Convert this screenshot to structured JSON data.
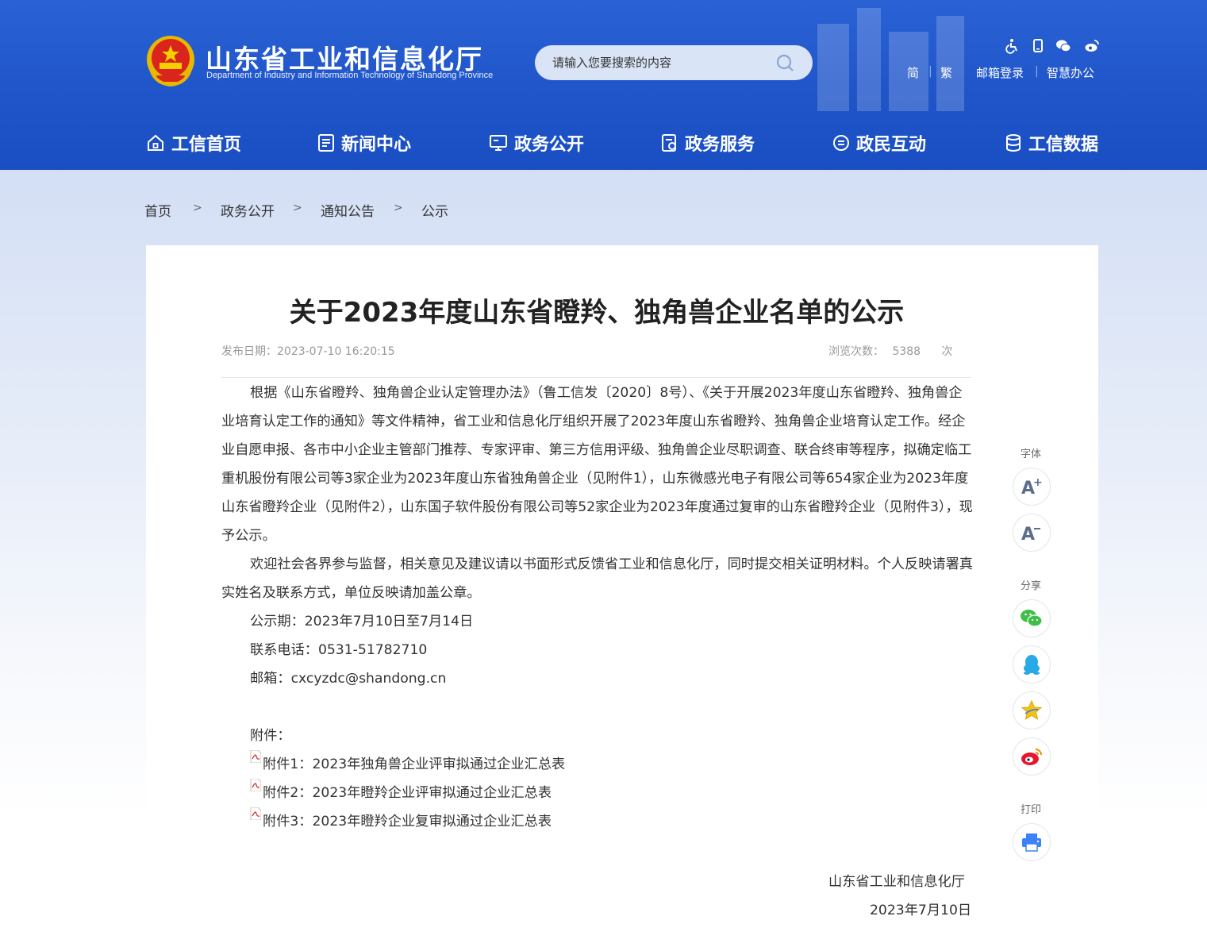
{
  "header": {
    "title": "山东省工业和信息化厅",
    "subtitle": "Department of Industry and Information Technology of Shandong Province",
    "search_placeholder": "请输入您要搜索的内容",
    "links": {
      "simplified": "简",
      "traditional": "繁",
      "mail_login": "邮箱登录",
      "smart_office": "智慧办公"
    },
    "separator": "|"
  },
  "nav": [
    {
      "label": "工信首页",
      "icon": "home-icon"
    },
    {
      "label": "新闻中心",
      "icon": "news-icon"
    },
    {
      "label": "政务公开",
      "icon": "monitor-icon"
    },
    {
      "label": "政务服务",
      "icon": "service-icon"
    },
    {
      "label": "政民互动",
      "icon": "chat-icon"
    },
    {
      "label": "工信数据",
      "icon": "database-icon"
    }
  ],
  "breadcrumb": {
    "items": [
      "首页",
      "政务公开",
      "通知公告",
      "公示"
    ],
    "sep": ">"
  },
  "article": {
    "title": "关于2023年度山东省瞪羚、独角兽企业名单的公示",
    "publish_label": "发布日期：",
    "publish_date": "2023-07-10 16:20:15",
    "views_label": "浏览次数：",
    "views": "5388",
    "views_unit": "次",
    "p1": "根据《山东省瞪羚、独角兽企业认定管理办法》（鲁工信发〔2020〕8号）、《关于开展2023年度山东省瞪羚、独角兽企业培育认定工作的通知》等文件精神，省工业和信息化厅组织开展了2023年度山东省瞪羚、独角兽企业培育认定工作。经企业自愿申报、各市中小企业主管部门推荐、专家评审、第三方信用评级、独角兽企业尽职调查、联合终审等程序，拟确定临工重机股份有限公司等3家企业为2023年度山东省独角兽企业（见附件1），山东微感光电子有限公司等654家企业为2023年度山东省瞪羚企业（见附件2），山东国子软件股份有限公司等52家企业为2023年度通过复审的山东省瞪羚企业（见附件3），现予公示。",
    "p2": "欢迎社会各界参与监督，相关意见及建议请以书面形式反馈省工业和信息化厅，同时提交相关证明材料。个人反映请署真实姓名及联系方式，单位反映请加盖公章。",
    "period": "公示期：2023年7月10日至7月14日",
    "phone": "联系电话：0531-51782710",
    "email": "邮箱：cxcyzdc@shandong.cn",
    "attach_label": "附件：",
    "attachments": [
      "附件1：2023年独角兽企业评审拟通过企业汇总表",
      "附件2：2023年瞪羚企业评审拟通过企业汇总表",
      "附件3：2023年瞪羚企业复审拟通过企业汇总表"
    ],
    "sign_org": "山东省工业和信息化厅",
    "sign_date": "2023年7月10日"
  },
  "side": {
    "font_label": "字体",
    "share_label": "分享",
    "print_label": "打印"
  },
  "colors": {
    "header_blue": "#1f55c9",
    "accent_red": "#e4393c"
  }
}
